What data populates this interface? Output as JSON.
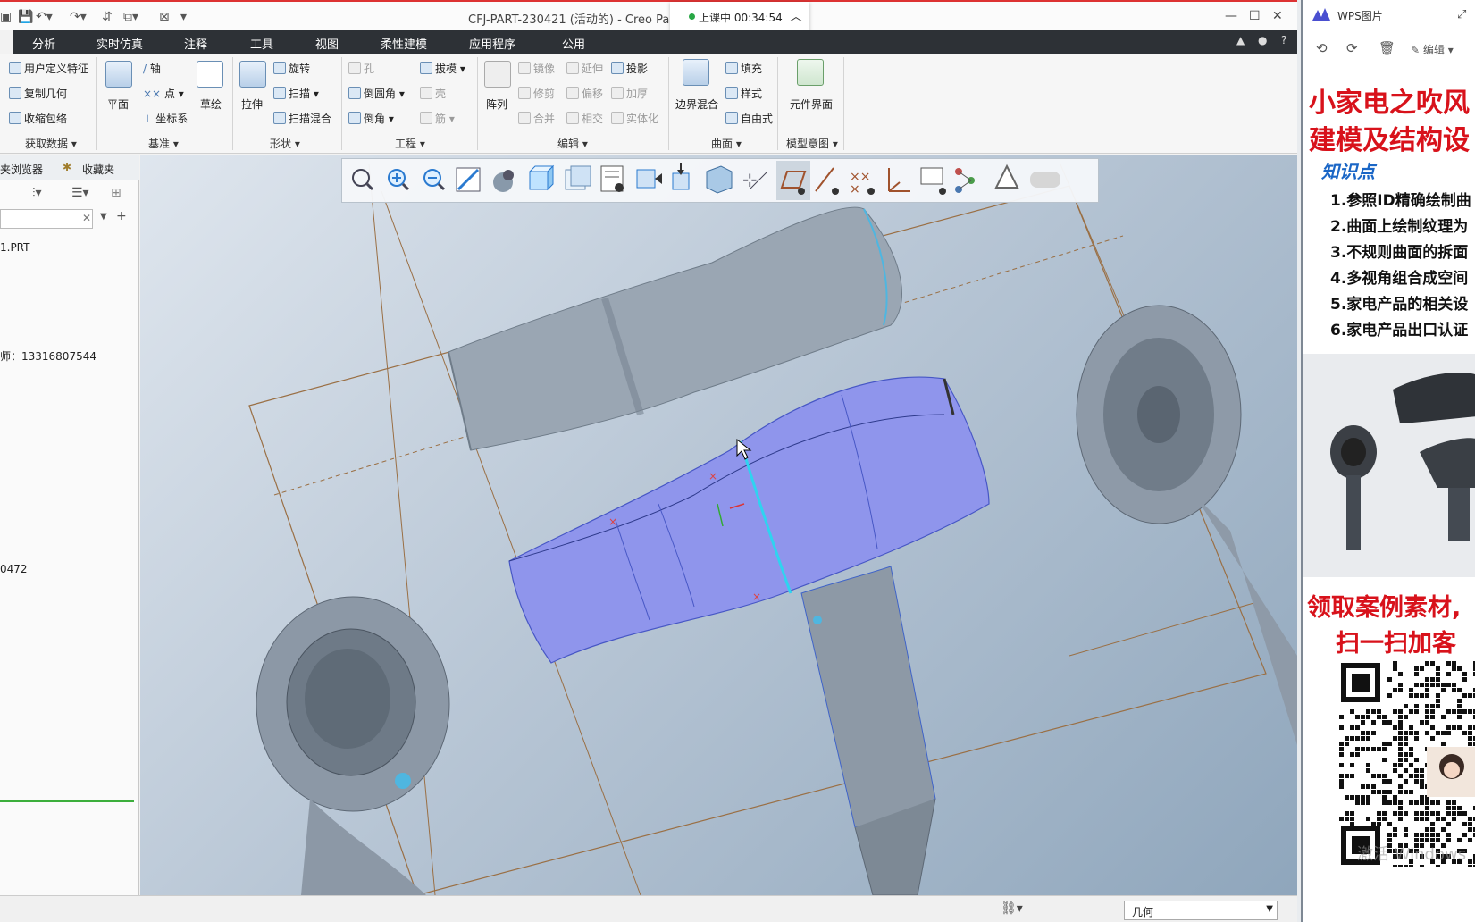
{
  "window": {
    "title": "CFJ-PART-230421 (活动的) - Creo Pa",
    "class_status": "上课中 00:34:54",
    "class_status_color": "#28a745"
  },
  "menu": {
    "tabs": [
      "分析",
      "实时仿真",
      "注释",
      "工具",
      "视图",
      "柔性建模",
      "应用程序",
      "公用"
    ]
  },
  "ribbon": {
    "get_data": {
      "items": [
        "用户定义特征",
        "复制几何",
        "收缩包络"
      ],
      "label": "获取数据"
    },
    "datum": {
      "plane": "平面",
      "axis": "轴",
      "point": "点",
      "csys": "坐标系",
      "sketch": "草绘",
      "label": "基准"
    },
    "shapes": {
      "extrude": "拉伸",
      "revolve": "旋转",
      "sweep": "扫描",
      "swept_blend": "扫描混合",
      "label": "形状"
    },
    "engineering": {
      "hole": "孔",
      "draft": "拔模",
      "round": "倒圆角",
      "shell": "壳",
      "chamfer": "倒角",
      "rib": "筋",
      "label": "工程"
    },
    "editing": {
      "pattern": "阵列",
      "mirror": "镜像",
      "extend": "延伸",
      "project": "投影",
      "trim": "修剪",
      "offset": "偏移",
      "thicken": "加厚",
      "merge": "合并",
      "intersect": "相交",
      "solidify": "实体化",
      "label": "编辑"
    },
    "surfaces": {
      "boundary_blend": "边界混合",
      "fill": "填充",
      "style": "样式",
      "freestyle": "自由式",
      "label": "曲面"
    },
    "model_intent": {
      "component_interface": "元件界面",
      "label": "模型意图"
    }
  },
  "left_panel": {
    "tab_browser": "夹浏览器",
    "tab_favorites": "收藏夹",
    "model_name": "1.PRT",
    "phone_line": "师：13316807544",
    "code_line": "0472"
  },
  "statusbar": {
    "filter_value": "几何"
  },
  "wps": {
    "title": "WPS图片",
    "edit_label": "编辑",
    "poster": {
      "headline_1": "小家电之吹风",
      "headline_2": "建模及结构设",
      "knowledge_label": "知识点",
      "points": [
        "1.参照ID精确绘制曲",
        "2.曲面上绘制纹理为",
        "3.不规则曲面的拆面",
        "4.多视角组合成空间",
        "5.家电产品的相关设",
        "6.家电产品出口认证"
      ],
      "cta_1": "领取案例素材,",
      "cta_2": "扫一扫加客",
      "watermark": "激活 Windows"
    }
  },
  "colors": {
    "menubar_bg": "#2d3136",
    "model_highlight": "#8f95ec",
    "poster_red": "#d8121b",
    "poster_blue": "#1a66c6"
  }
}
